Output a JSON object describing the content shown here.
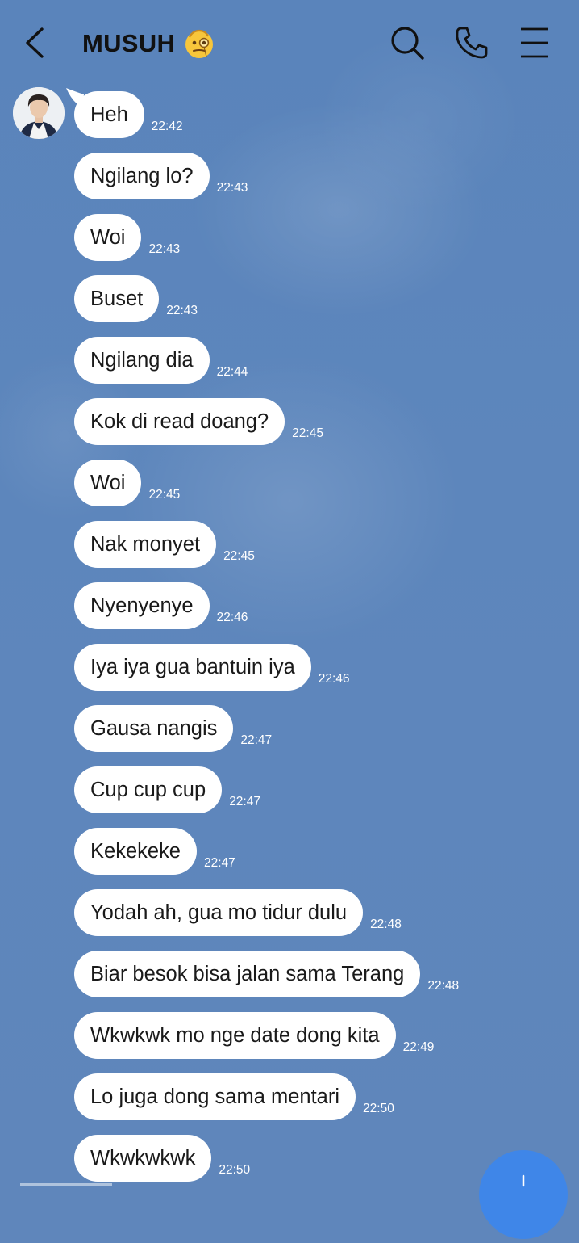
{
  "header": {
    "title": "MUSUH",
    "title_emoji": "face-with-monocle-emoji",
    "icons": [
      "back-chevron-icon",
      "search-icon",
      "phone-icon",
      "menu-icon"
    ]
  },
  "chat": {
    "avatar": "contact-avatar",
    "messages": [
      {
        "text": "Heh",
        "time": "22:42"
      },
      {
        "text": "Ngilang lo?",
        "time": "22:43"
      },
      {
        "text": "Woi",
        "time": "22:43"
      },
      {
        "text": "Buset",
        "time": "22:43"
      },
      {
        "text": "Ngilang dia",
        "time": "22:44"
      },
      {
        "text": "Kok di read doang?",
        "time": "22:45"
      },
      {
        "text": "Woi",
        "time": "22:45"
      },
      {
        "text": "Nak monyet",
        "time": "22:45"
      },
      {
        "text": "Nyenyenye",
        "time": "22:46"
      },
      {
        "text": "Iya iya gua bantuin iya",
        "time": "22:46"
      },
      {
        "text": "Gausa nangis",
        "time": "22:47"
      },
      {
        "text": "Cup cup cup",
        "time": "22:47"
      },
      {
        "text": "Kekekeke",
        "time": "22:47"
      },
      {
        "text": "Yodah ah, gua mo tidur dulu",
        "time": "22:48"
      },
      {
        "text": "Biar besok bisa jalan sama Terang",
        "time": "22:48"
      },
      {
        "text": "Wkwkwk mo nge date dong kita",
        "time": "22:49"
      },
      {
        "text": "Lo juga dong sama mentari",
        "time": "22:50"
      },
      {
        "text": "Wkwkwkwk",
        "time": "22:50"
      }
    ]
  },
  "colors": {
    "background": "#5f86bb",
    "bubble": "#ffffff",
    "fab": "#3f86e8"
  }
}
